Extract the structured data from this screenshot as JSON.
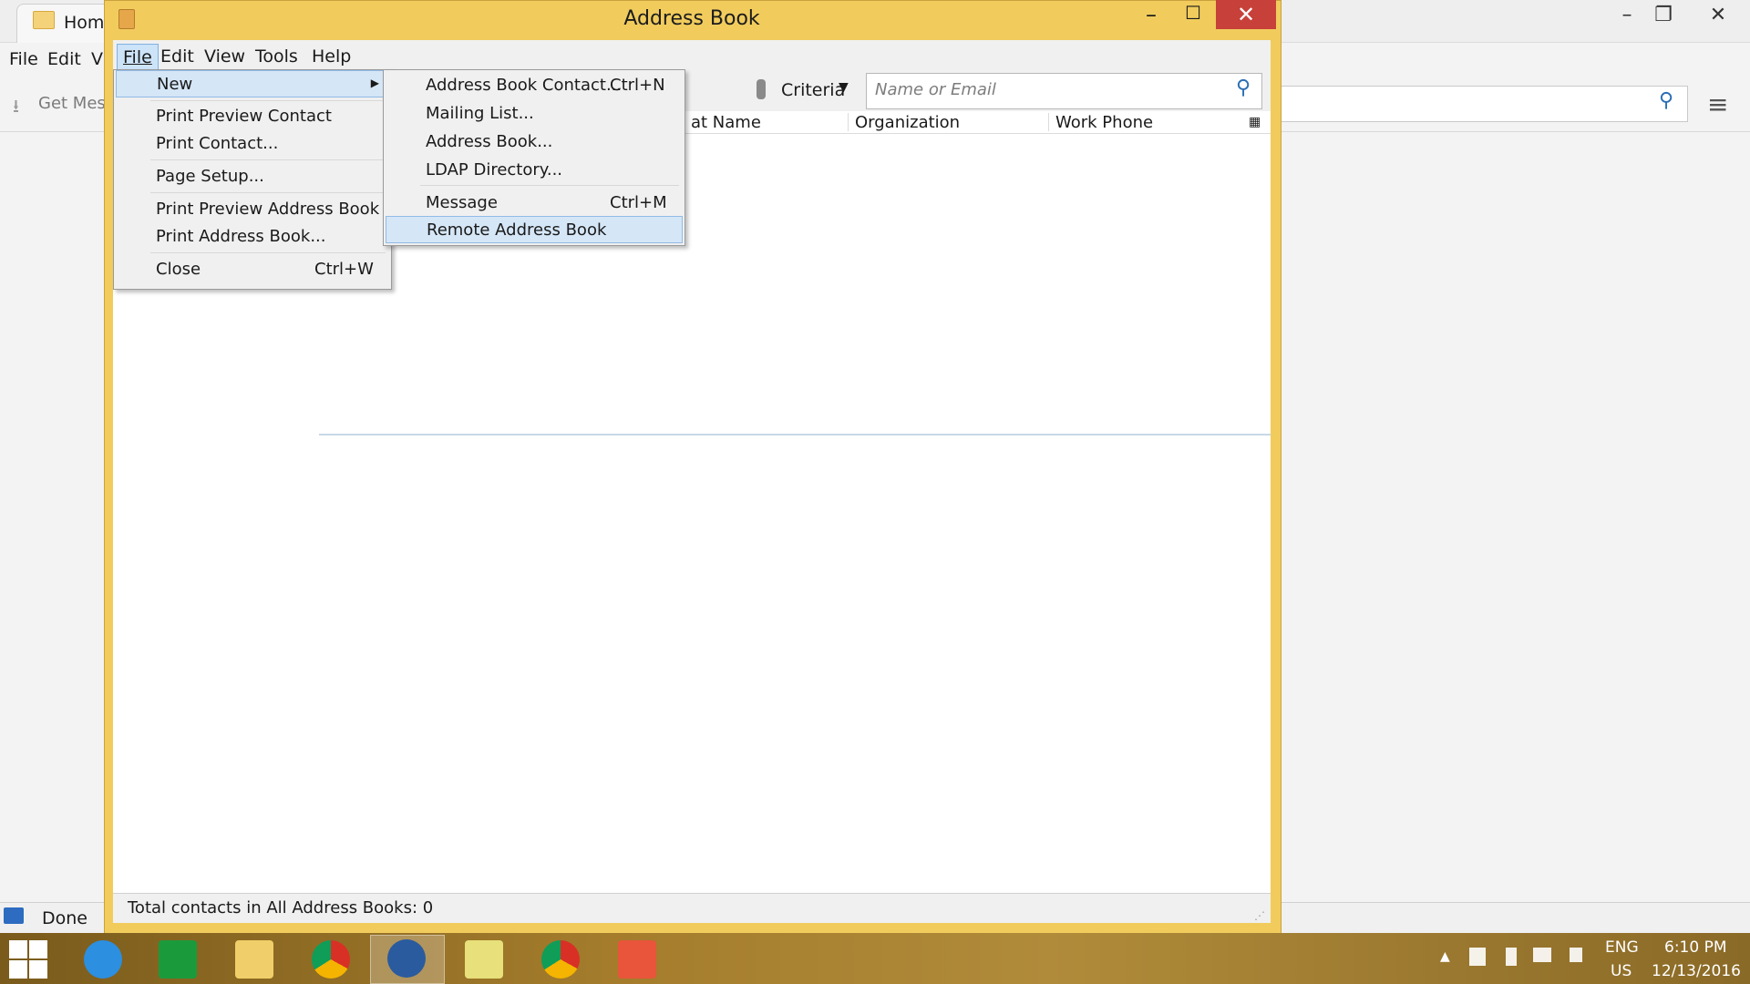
{
  "background_app": {
    "tab_label": "Home",
    "menu": [
      "File",
      "Edit",
      "Vi"
    ],
    "toolbar_button": "Get Mess",
    "status_text": "Done"
  },
  "window": {
    "title": "Address Book",
    "controls": {
      "minimize": "–",
      "maximize": "☐",
      "close": "✕"
    }
  },
  "menubar": {
    "items": [
      "File",
      "Edit",
      "View",
      "Tools",
      "Help"
    ]
  },
  "toolbar": {
    "criteria_label": "Criteria",
    "search_placeholder": "Name or Email"
  },
  "contacts_table": {
    "columns": [
      "at Name",
      "Organization",
      "Work Phone"
    ],
    "rows": []
  },
  "status": {
    "text": "Total contacts in All Address Books: 0"
  },
  "file_menu": {
    "items": [
      {
        "label": "New",
        "accel": "",
        "submenu": true,
        "highlighted": true
      },
      {
        "label": "Print Preview Contact",
        "accel": ""
      },
      {
        "label": "Print Contact...",
        "accel": ""
      },
      {
        "label": "Page Setup...",
        "accel": ""
      },
      {
        "label": "Print Preview Address Book",
        "accel": ""
      },
      {
        "label": "Print Address Book...",
        "accel": ""
      },
      {
        "label": "Close",
        "accel": "Ctrl+W"
      }
    ]
  },
  "new_submenu": {
    "items": [
      {
        "label": "Address Book Contact...",
        "accel": "Ctrl+N"
      },
      {
        "label": "Mailing List...",
        "accel": ""
      },
      {
        "label": "Address Book...",
        "accel": ""
      },
      {
        "label": "LDAP Directory...",
        "accel": ""
      },
      {
        "label": "Message",
        "accel": "Ctrl+M"
      },
      {
        "label": "Remote Address Book",
        "accel": "",
        "highlighted": true
      }
    ]
  },
  "taskbar": {
    "apps": [
      "internet-explorer",
      "store",
      "file-explorer",
      "chrome",
      "thunderbird",
      "sticky-notes",
      "chrome",
      "screen-recorder"
    ],
    "active_app": "thunderbird",
    "language_line1": "ENG",
    "language_line2": "US",
    "time": "6:10 PM",
    "date": "12/13/2016"
  },
  "colors": {
    "window_frame": "#f1cc5d",
    "close_button": "#c7403a",
    "menu_highlight": "#d5e6f7",
    "taskbar": "#a47c2c"
  }
}
